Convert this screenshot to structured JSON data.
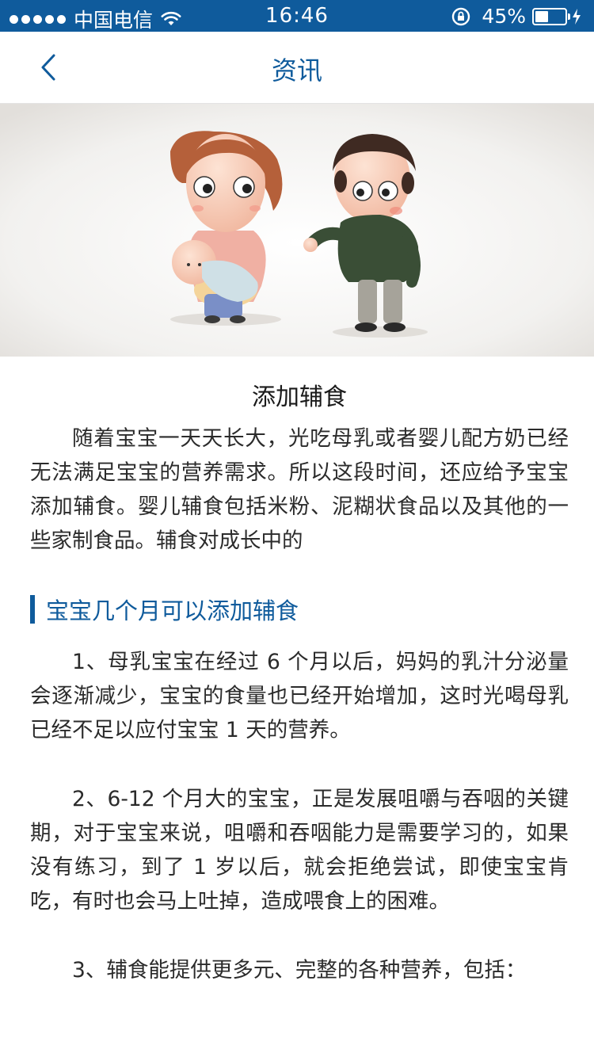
{
  "status_bar": {
    "carrier": "中国电信",
    "time": "16:46",
    "battery_percent_text": "45%",
    "battery_level": 0.45
  },
  "nav": {
    "title": "资讯"
  },
  "article": {
    "title": "添加辅食",
    "intro": "随着宝宝一天天长大，光吃母乳或者婴儿配方奶已经无法满足宝宝的营养需求。所以这段时间，还应给予宝宝添加辅食。婴儿辅食包括米粉、泥糊状食品以及其他的一些家制食品。辅食对成长中的",
    "section_title": "宝宝几个月可以添加辅食",
    "points": [
      "1、母乳宝宝在经过 6 个月以后，妈妈的乳汁分泌量会逐渐减少，宝宝的食量也已经开始增加，这时光喝母乳已经不足以应付宝宝 1 天的营养。",
      "2、6-12 个月大的宝宝，正是发展咀嚼与吞咽的关键期，对于宝宝来说，咀嚼和吞咽能力是需要学习的，如果没有练习，到了 1 岁以后，就会拒绝尝试，即使宝宝肯吃，有时也会马上吐掉，造成喂食上的困难。",
      "3、辅食能提供更多元、完整的各种营养，包括："
    ]
  },
  "colors": {
    "brand_blue": "#0f5b9c",
    "body_text": "#2b2b2b"
  },
  "icons": {
    "back": "chevron-left-icon",
    "wifi": "wifi-icon",
    "lock": "orientation-lock-icon",
    "charging": "charging-bolt-icon"
  }
}
